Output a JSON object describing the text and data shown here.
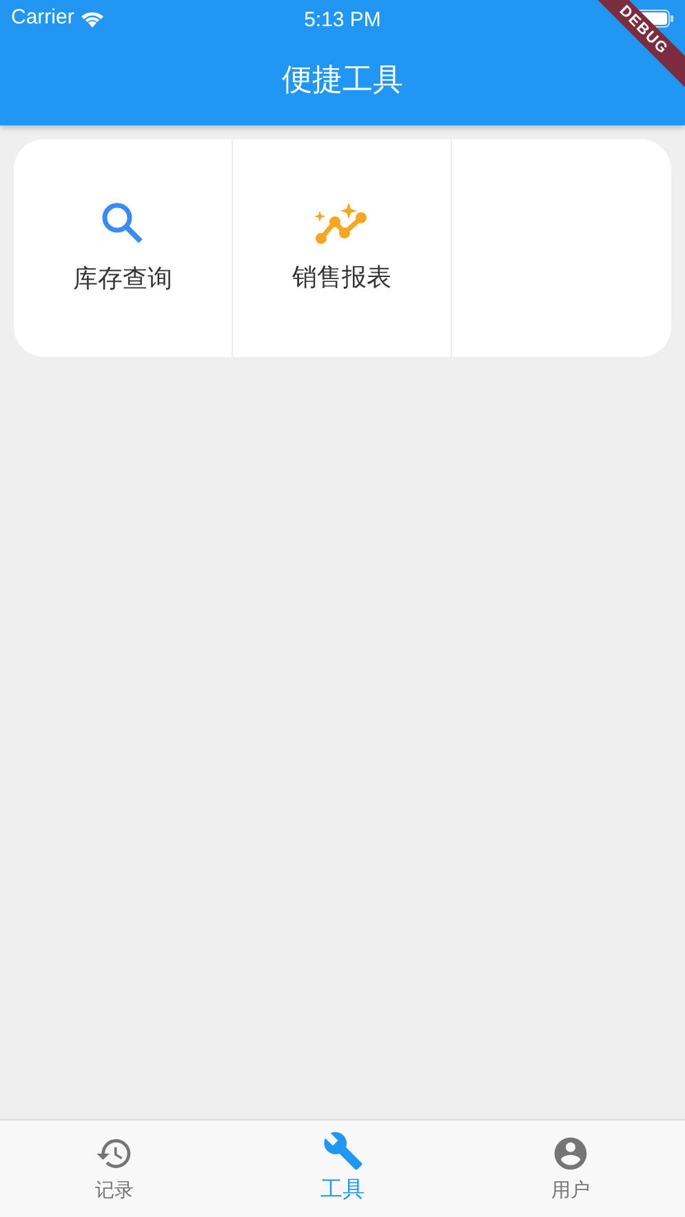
{
  "status_bar": {
    "carrier": "Carrier",
    "time": "5:13 PM"
  },
  "debug_banner": "DEBUG",
  "app_bar": {
    "title": "便捷工具"
  },
  "tools": [
    {
      "label": "库存查询"
    },
    {
      "label": "销售报表"
    }
  ],
  "bottom_nav": [
    {
      "label": "记录",
      "selected": false
    },
    {
      "label": "工具",
      "selected": true
    },
    {
      "label": "用户",
      "selected": false
    }
  ]
}
